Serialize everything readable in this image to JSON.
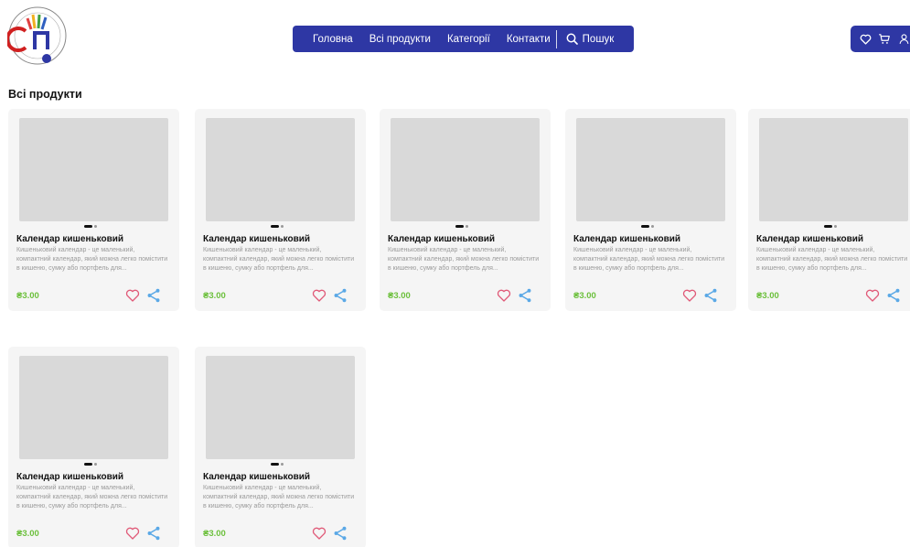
{
  "nav": {
    "items": [
      "Головна",
      "Всі продукти",
      "Категорії",
      "Контакти"
    ],
    "search_label": "Пошук"
  },
  "page": {
    "title": "Всі продукти"
  },
  "colors": {
    "nav_bg": "#2e37a4",
    "price": "#6cc03c",
    "heart": "#e05a78",
    "share": "#5aa8e6",
    "card_bg": "#f5f5f5",
    "placeholder": "#d9d9d9"
  },
  "icons": {
    "header": [
      "heart-icon",
      "cart-icon",
      "user-icon"
    ],
    "card": [
      "heart-icon",
      "share-icon"
    ]
  },
  "products": [
    {
      "title": "Календар кишеньковий",
      "description": "Кишеньковий календар - це маленький, компактний календар, який можна легко помістити в кишеню, сумку або портфель для...",
      "price": "₴3.00"
    },
    {
      "title": "Календар кишеньковий",
      "description": "Кишеньковий календар - це маленький, компактний календар, який можна легко помістити в кишеню, сумку або портфель для...",
      "price": "₴3.00"
    },
    {
      "title": "Календар кишеньковий",
      "description": "Кишеньковий календар - це маленький, компактний календар, який можна легко помістити в кишеню, сумку або портфель для...",
      "price": "₴3.00"
    },
    {
      "title": "Календар кишеньковий",
      "description": "Кишеньковий календар - це маленький, компактний календар, який можна легко помістити в кишеню, сумку або портфель для...",
      "price": "₴3.00"
    },
    {
      "title": "Календар кишеньковий",
      "description": "Кишеньковий календар - це маленький, компактний календар, який можна легко помістити в кишеню, сумку або портфель для...",
      "price": "₴3.00"
    },
    {
      "title": "Календар кишеньковий",
      "description": "Кишеньковий календар - це маленький, компактний календар, який можна легко помістити в кишеню, сумку або портфель для...",
      "price": "₴3.00"
    },
    {
      "title": "Календар кишеньковий",
      "description": "Кишеньковий календар - це маленький, компактний календар, який можна легко помістити в кишеню, сумку або портфель для...",
      "price": "₴3.00"
    }
  ]
}
